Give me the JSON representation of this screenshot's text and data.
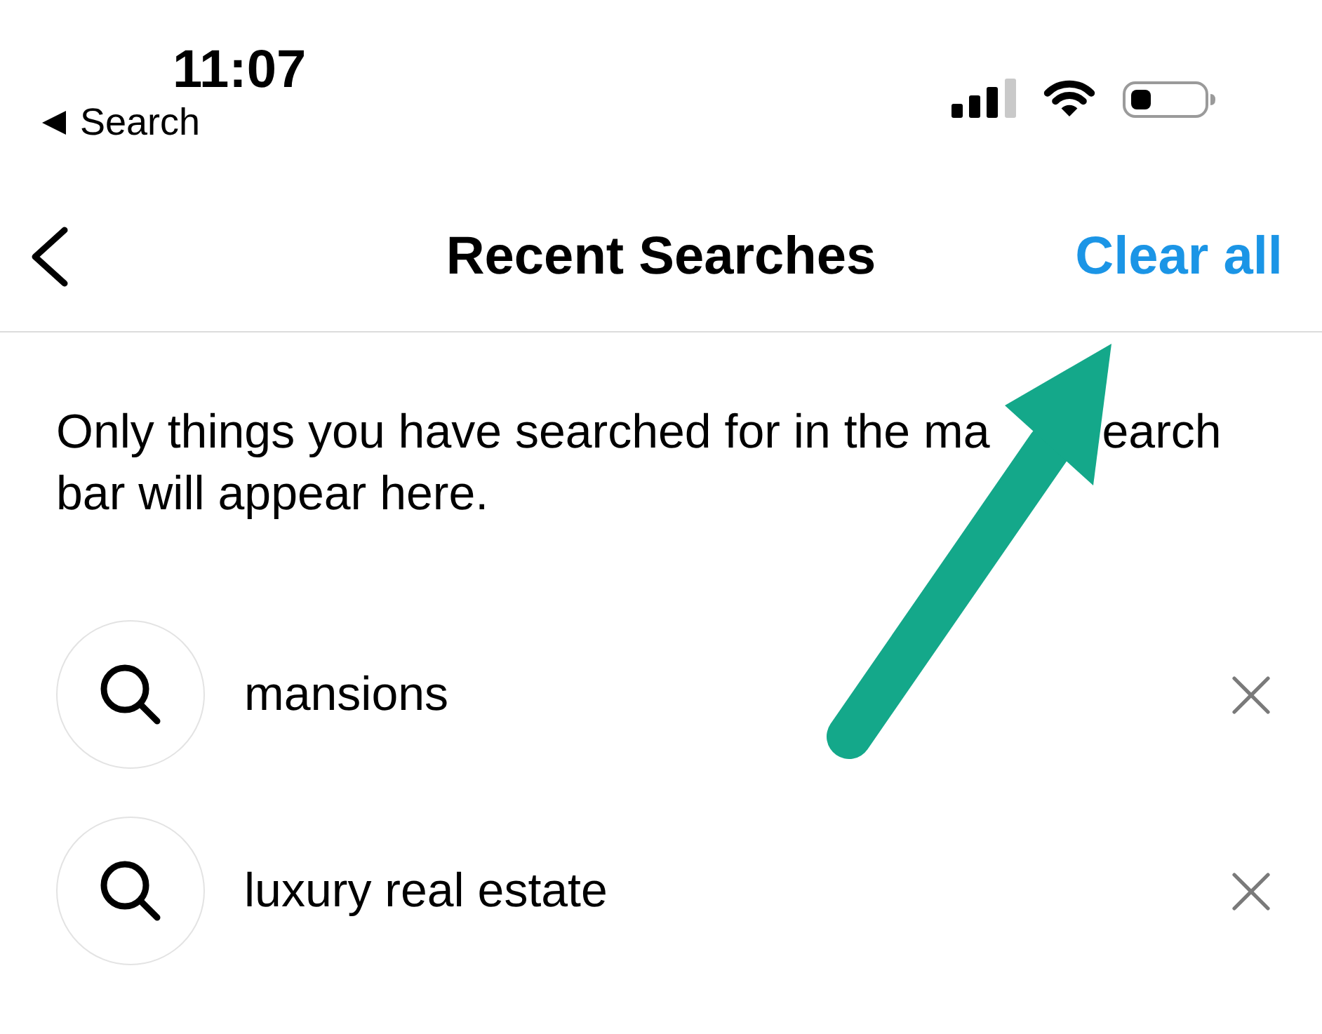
{
  "status_bar": {
    "time": "11:07",
    "back_link": "Search"
  },
  "header": {
    "title": "Recent Searches",
    "action": "Clear all"
  },
  "note": {
    "line_1": [
      "Only things you have searched for in the ma",
      "earch"
    ],
    "line_2": "bar will appear here."
  },
  "recent_searches": [
    {
      "query": "mansions"
    },
    {
      "query": "luxury real estate"
    }
  ]
}
